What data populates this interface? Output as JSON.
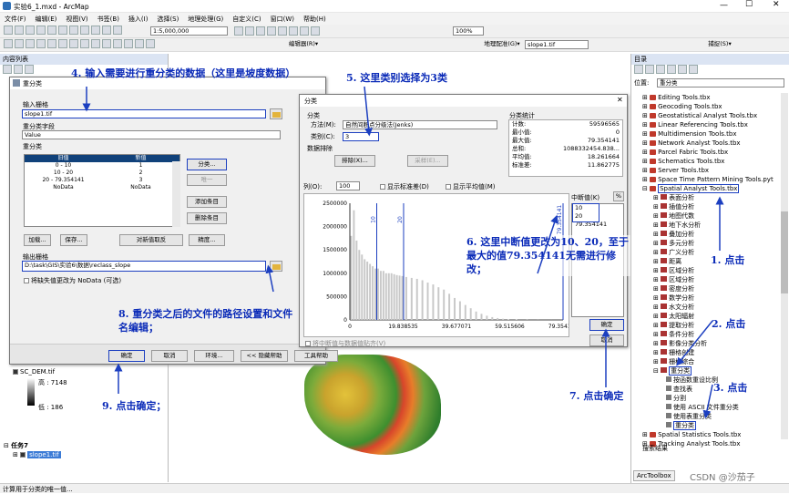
{
  "window": {
    "title": "实验6_1.mxd - ArcMap"
  },
  "menu": [
    "文件(F)",
    "编辑(E)",
    "视图(V)",
    "书签(B)",
    "插入(I)",
    "选择(S)",
    "地理处理(G)",
    "自定义(C)",
    "窗口(W)",
    "帮助(H)"
  ],
  "toolbar": {
    "scale": "1:5,000,000",
    "zoom": "100%",
    "editor": "编辑器(R)▾",
    "georef": "地理配准(G)▾",
    "layer": "slope1.tif",
    "capture": "捕捉(S)▾"
  },
  "toc": {
    "title": "内容列表",
    "dem_name": "SC_DEM.tif",
    "high": "高 : 7148",
    "low": "低 : 186",
    "task": "任务7",
    "slope": "slope1.tif"
  },
  "reclass": {
    "title": "重分类",
    "input_label": "输入栅格",
    "input_value": "slope1.tif",
    "field_label": "重分类字段",
    "field_value": "Value",
    "group_label": "重分类",
    "col_old": "旧值",
    "col_new": "新值",
    "rows": [
      [
        "0 - 10",
        "1"
      ],
      [
        "10 - 20",
        "2"
      ],
      [
        "20 - 79.354141",
        "3"
      ],
      [
        "NoData",
        "NoData"
      ]
    ],
    "btn_classify": "分类...",
    "btn_unique": "唯一",
    "btn_add": "添加条目",
    "btn_delete": "删除条目",
    "btn_load": "加载...",
    "btn_save": "保存...",
    "btn_reverse": "对新值取反",
    "btn_precision": "精度...",
    "output_label": "输出栅格",
    "output_value": "D:\\task\\GIS\\实验6\\数据\\reclass_slope",
    "nodata_label": "将缺失值更改为 NoData (可选)",
    "ok": "确定",
    "cancel": "取消",
    "env": "环境...",
    "hide_help": "<< 隐藏帮助",
    "tool_help": "工具帮助"
  },
  "classify": {
    "title": "分类",
    "section": "分类",
    "method_label": "方法(M):",
    "method_value": "自然间断点分级法(Jenks)",
    "classes_label": "类别(C):",
    "classes_value": "3",
    "exclusion": "数据排除",
    "btn_exclude": "排除(X)...",
    "btn_sample": "采样(E)...",
    "stats_title": "分类统计",
    "stats": [
      [
        "计数:",
        "59596565"
      ],
      [
        "最小值:",
        "0"
      ],
      [
        "最大值:",
        "79.354141"
      ],
      [
        "总和:",
        "1088332454.838..."
      ],
      [
        "平均值:",
        "18.261664"
      ],
      [
        "标准差:",
        "11.862775"
      ]
    ],
    "columns_label": "列(O):",
    "columns_value": "100",
    "show_std": "显示标准差(D)",
    "show_mean": "显示平均值(M)",
    "y_ticks": [
      "2500000",
      "2000000",
      "1500000",
      "1000000",
      "500000",
      "0"
    ],
    "x_ticks": [
      "0",
      "19.838535",
      "39.677071",
      "59.515606",
      "79.354141"
    ],
    "break_labels": [
      "10",
      "20",
      "79.354141"
    ],
    "breaks_title": "中断值(K)",
    "percent": "%",
    "breaks": [
      "10",
      "20",
      "79.354141"
    ],
    "snap": "将中断值与数据值贴齐(V)",
    "ok": "确定",
    "cancel": "取消"
  },
  "catalog": {
    "title": "目录",
    "location": "重分类",
    "items": [
      "Editing Tools.tbx",
      "Geocoding Tools.tbx",
      "Geostatistical Analyst Tools.tbx",
      "Linear Referencing Tools.tbx",
      "Multidimension Tools.tbx",
      "Network Analyst Tools.tbx",
      "Parcel Fabric Tools.tbx",
      "Schematics Tools.tbx",
      "Server Tools.tbx",
      "Space Time Pattern Mining Tools.pyt",
      "Spatial Analyst Tools.tbx"
    ],
    "sub": [
      "表面分析",
      "插值分析",
      "地图代数",
      "地下水分析",
      "叠加分析",
      "多元分析",
      "广义分析",
      "距离",
      "区域分析",
      "区域分析",
      "密度分析",
      "数学分析",
      "水文分析",
      "太阳辐射",
      "提取分析",
      "条件分析",
      "影像分类分析",
      "栅格创建",
      "栅格综合",
      "重分类"
    ],
    "reclass_items": [
      "按函数重设比例",
      "查找表",
      "分割",
      "使用 ASCII 文件重分类",
      "使用表重分类",
      "重分类"
    ],
    "tail": [
      "Spatial Statistics Tools.tbx",
      "Tracking Analyst Tools.tbx"
    ],
    "search": "搜索结果",
    "tab": "ArcToolbox",
    "location_label": "位置:"
  },
  "status": {
    "text": "计算用于分类的唯一值..."
  },
  "annotations": {
    "a1": "1. 点击",
    "a2": "2. 点击",
    "a3": "3. 点击",
    "a4": "4. 输入需要进行重分类的数据（这里是坡度数据）",
    "a5": "5. 这里类别选择为3类",
    "a6": "6. 这里中断值更改为10、20，至于最大的值79.354141无需进行修改；",
    "a7": "7. 点击确定",
    "a8": "8. 重分类之后的文件的路径设置和文件名编辑；",
    "a9": "9. 点击确定；"
  },
  "watermark": "CSDN @沙茄子",
  "chart_data": {
    "type": "bar",
    "title": "",
    "xlabel": "",
    "ylabel": "",
    "xlim": [
      0,
      79.354141
    ],
    "ylim": [
      0,
      2500000
    ],
    "breaks": [
      10,
      20,
      79.354141
    ],
    "x": [
      0.5,
      1.5,
      2.5,
      3.5,
      4.5,
      5.5,
      6.5,
      7.5,
      8.5,
      9.5,
      10.5,
      11.5,
      12.5,
      13.5,
      14.5,
      15.5,
      16.5,
      17.5,
      18.5,
      19.5,
      21,
      23,
      25,
      27,
      29,
      31,
      33,
      35,
      37,
      39,
      41,
      43,
      45,
      47,
      49,
      51,
      53,
      55,
      57,
      59,
      62,
      66,
      70,
      75
    ],
    "values": [
      1800000,
      2350000,
      1700000,
      1500000,
      1400000,
      1300000,
      1250000,
      1200000,
      1150000,
      1100000,
      1100000,
      1050000,
      1050000,
      1000000,
      1000000,
      1000000,
      980000,
      960000,
      950000,
      940000,
      920000,
      900000,
      880000,
      850000,
      800000,
      760000,
      700000,
      650000,
      560000,
      470000,
      400000,
      320000,
      250000,
      180000,
      130000,
      90000,
      60000,
      40000,
      25000,
      15000,
      8000,
      4000,
      2000,
      500
    ]
  }
}
